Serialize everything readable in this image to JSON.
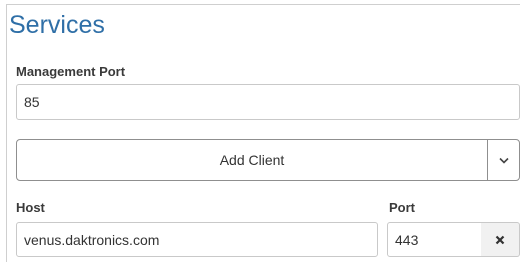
{
  "section": {
    "title": "Services"
  },
  "management_port": {
    "label": "Management Port",
    "value": "85"
  },
  "add_client": {
    "label": "Add Client",
    "toggle_icon": "chevron-down-icon"
  },
  "client_row": {
    "host_label": "Host",
    "host_value": "venus.daktronics.com",
    "port_label": "Port",
    "port_value": "443",
    "remove_icon": "close-icon"
  }
}
